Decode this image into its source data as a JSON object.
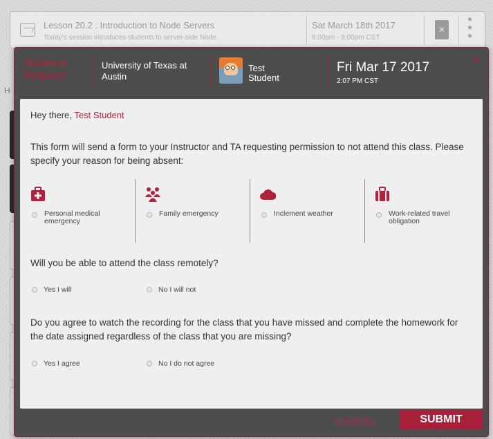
{
  "background": {
    "lesson_title": "Lesson 20.2 : Introduction to Node Servers",
    "lesson_subtitle": "Today's session introduces students to server-side Node.",
    "lesson_date": "Sat March 18th 2017",
    "lesson_time": "6:00pm - 9:00pm CST",
    "left_letter": "H",
    "stars": "★\n★\n★"
  },
  "modal": {
    "title": "Absence Request",
    "university": "University of Texas at Austin",
    "student_name": "Test Student",
    "date": "Fri Mar 17 2017",
    "time": "2:07 PM CST",
    "close": "×",
    "greeting_prefix": "Hey there,",
    "greeting_name": "Test Student",
    "intro": "This form will send a form to your Instructor and TA requesting permission to not attend this class. Please specify your reason for being absent:",
    "reasons": [
      {
        "label": "Personal medical emergency",
        "icon": "medical-kit-icon"
      },
      {
        "label": "Family emergency",
        "icon": "family-icon"
      },
      {
        "label": "Inclement weather",
        "icon": "cloud-icon"
      },
      {
        "label": "Work-related travel obligation",
        "icon": "briefcase-icon"
      }
    ],
    "remote_question": "Will you be able to attend the class remotely?",
    "remote_options": [
      "Yes I will",
      "No I will not"
    ],
    "recording_question": "Do you agree to watch the recording for the class that you have missed and complete the homework for the date assigned regardless of the class that you are missing?",
    "recording_options": [
      "Yes I agree",
      "No I do not agree"
    ],
    "cancel_label": "CANCEL",
    "submit_label": "SUBMIT"
  },
  "colors": {
    "accent": "#b0213c",
    "modal_bg": "#4d4d4d",
    "body_bg": "#efefef"
  }
}
